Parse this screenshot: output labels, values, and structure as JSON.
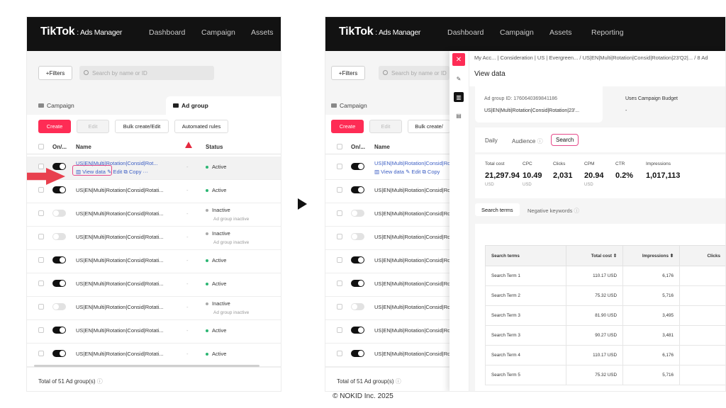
{
  "app": {
    "logo": "TikTok",
    "logo_suffix": ": Ads Manager",
    "nav": [
      "Dashboard",
      "Campaign",
      "Assets",
      "Reporting"
    ]
  },
  "filters": {
    "button": "+Filters",
    "search_placeholder": "Search by name or ID"
  },
  "tabs": {
    "campaign": "Campaign",
    "adgroup": "Ad group"
  },
  "toolbar": {
    "create": "Create",
    "edit": "Edit",
    "bulk": "Bulk create/Edit",
    "bulk_short": "Bulk create/",
    "rules": "Automated rules"
  },
  "table": {
    "col_onoff": "On/...",
    "col_name": "Name",
    "col_status": "Status"
  },
  "first_row": {
    "name": "US|EN|Multi|Rotation|Consid|Rot...",
    "name_right": "US|EN|Multi|Rotation|Consid|Rotati",
    "view": "View data",
    "edit": "Edit",
    "copy": "Copy",
    "more": "···"
  },
  "rows": [
    {
      "name": "US|EN|Multi|Rotation|Consid|Rotati...",
      "status": "Active",
      "sub": "",
      "on": true
    },
    {
      "name": "US|EN|Multi|Rotation|Consid|Rotati...",
      "status": "Active",
      "sub": "",
      "on": true
    },
    {
      "name": "US|EN|Multi|Rotation|Consid|Rotati...",
      "status": "Inactive",
      "sub": "Ad group inactive",
      "on": false
    },
    {
      "name": "US|EN|Multi|Rotation|Consid|Rotati...",
      "status": "Inactive",
      "sub": "Ad group inactive",
      "on": false
    },
    {
      "name": "US|EN|Multi|Rotation|Consid|Rotati...",
      "status": "Active",
      "sub": "",
      "on": true
    },
    {
      "name": "US|EN|Multi|Rotation|Consid|Rotati...",
      "status": "Active",
      "sub": "",
      "on": true
    },
    {
      "name": "US|EN|Multi|Rotation|Consid|Rotati...",
      "status": "Inactive",
      "sub": "Ad group inactive",
      "on": false
    },
    {
      "name": "US|EN|Multi|Rotation|Consid|Rotati...",
      "status": "Active",
      "sub": "",
      "on": true
    },
    {
      "name": "US|EN|Multi|Rotation|Consid|Rotati...",
      "status": "Active",
      "sub": "",
      "on": true
    }
  ],
  "rows_right": [
    "US|EN|Multi|Rotation|Consid|Rotati",
    "US|EN|Multi|Rotation|Consid|Rotati",
    "US|EN|Multi|Rotation|Consid|Rotati",
    "US|EN|Multi|Rotation|Consid|Rotati",
    "US|EN|Multi|Rotation|Consid|Rotati",
    "US|EN|Multi|Rotation|Consid|Rotati",
    "US|EN|Multi|Rotation|Consid|Rotati",
    "US|EN|Multi|Rotation|Consid|Rotati"
  ],
  "footer": {
    "total": "Total of 51 Ad group(s)"
  },
  "panel": {
    "breadcrumb": "My Acc... | Consideration | US | Evergreen...  /  US|EN|Multi|Rotation|Consid|Rotation|23'Q2|... / 8 Ad",
    "title": "View data",
    "adgroup_id": "Ad group ID: 1760640369841186",
    "adgroup_name": "US|EN|Multi|Rotation|Consid|Rotation|23'...",
    "budget_label": "Uses Campaign Budget",
    "budget_value": "-",
    "tabs": {
      "daily": "Daily",
      "audience": "Audience",
      "search": "Search"
    },
    "metrics": [
      {
        "label": "Total cost",
        "value": "21,297.94",
        "unit": "USD"
      },
      {
        "label": "CPC",
        "value": "10.49",
        "unit": "USD"
      },
      {
        "label": "Clicks",
        "value": "2,031",
        "unit": ""
      },
      {
        "label": "CPM",
        "value": "20.94",
        "unit": "USD"
      },
      {
        "label": "CTR",
        "value": "0.2%",
        "unit": ""
      },
      {
        "label": "Impressions",
        "value": "1,017,113",
        "unit": ""
      }
    ],
    "subtabs": {
      "terms": "Search terms",
      "negative": "Negative keywords"
    },
    "search_table": {
      "headers": [
        "Search terms",
        "Total cost",
        "Impressions",
        "Clicks"
      ],
      "rows": [
        [
          "Search Term 1",
          "110.17 USD",
          "6,176"
        ],
        [
          "Search Term 2",
          "75.32 USD",
          "5,716"
        ],
        [
          "Search Term 3",
          "81.90 USD",
          "3,495"
        ],
        [
          "Search Term 3",
          "90.27 USD",
          "3,481"
        ],
        [
          "Search Term 4",
          "110.17 USD",
          "6,176"
        ],
        [
          "Search Term 5",
          "75.32 USD",
          "5,716"
        ]
      ]
    }
  },
  "copyright": "© NOKID Inc. 2025"
}
